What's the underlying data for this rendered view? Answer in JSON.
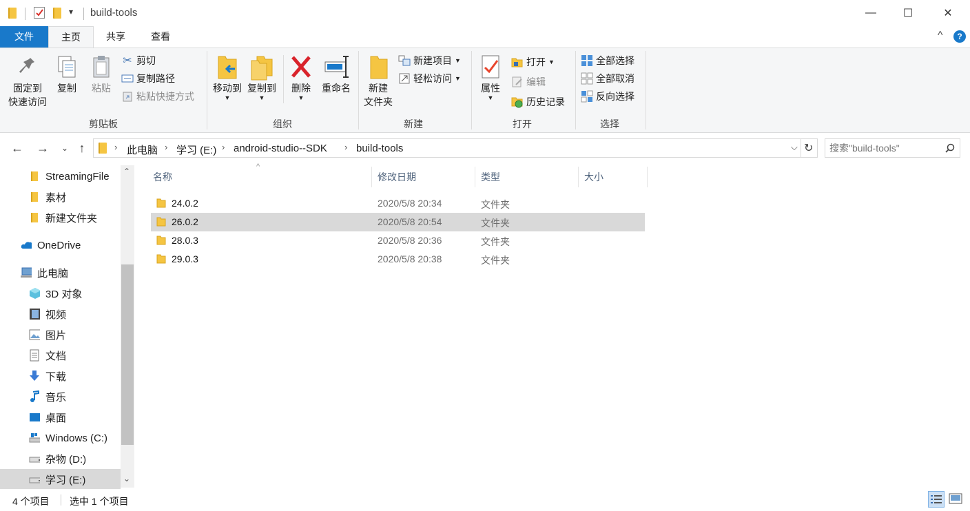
{
  "titlebar": {
    "title": "build-tools",
    "quick_access_dropdown": "▾",
    "minimize": "—",
    "maximize": "☐",
    "close": "✕"
  },
  "ribbon_tabs": {
    "file": "文件",
    "home": "主页",
    "share": "共享",
    "view": "查看",
    "collapse": "^",
    "help": "?"
  },
  "ribbon": {
    "clipboard": {
      "label": "剪贴板",
      "pin_line1": "固定到",
      "pin_line2": "快速访问",
      "copy": "复制",
      "paste": "粘贴",
      "cut": "剪切",
      "copy_path": "复制路径",
      "paste_shortcut": "粘贴快捷方式"
    },
    "organize": {
      "label": "组织",
      "move_to": "移动到",
      "copy_to": "复制到",
      "delete": "删除",
      "rename": "重命名"
    },
    "new": {
      "label": "新建",
      "new_folder_line1": "新建",
      "new_folder_line2": "文件夹",
      "new_item": "新建项目",
      "easy_access": "轻松访问"
    },
    "open": {
      "label": "打开",
      "properties": "属性",
      "open": "打开",
      "edit": "编辑",
      "history": "历史记录"
    },
    "select": {
      "label": "选择",
      "select_all": "全部选择",
      "select_none": "全部取消",
      "invert": "反向选择"
    }
  },
  "address": {
    "breadcrumbs": [
      "此电脑",
      "学习 (E:)",
      "android-studio--SDK",
      "build-tools"
    ],
    "search_placeholder": "搜索\"build-tools\""
  },
  "nav": {
    "items": [
      {
        "label": "StreamingFile",
        "icon": "folder-icon",
        "indent": 1
      },
      {
        "label": "素材",
        "icon": "folder-icon",
        "indent": 1
      },
      {
        "label": "新建文件夹",
        "icon": "folder-icon",
        "indent": 1
      },
      {
        "label": "OneDrive",
        "icon": "onedrive-icon",
        "indent": 0
      },
      {
        "label": "此电脑",
        "icon": "computer-icon",
        "indent": 0
      },
      {
        "label": "3D 对象",
        "icon": "3d-objects-icon",
        "indent": 1
      },
      {
        "label": "视频",
        "icon": "video-icon",
        "indent": 1
      },
      {
        "label": "图片",
        "icon": "pictures-icon",
        "indent": 1
      },
      {
        "label": "文档",
        "icon": "documents-icon",
        "indent": 1
      },
      {
        "label": "下载",
        "icon": "downloads-icon",
        "indent": 1
      },
      {
        "label": "音乐",
        "icon": "music-icon",
        "indent": 1
      },
      {
        "label": "桌面",
        "icon": "desktop-icon",
        "indent": 1
      },
      {
        "label": "Windows (C:)",
        "icon": "windows-drive-icon",
        "indent": 1
      },
      {
        "label": "杂物 (D:)",
        "icon": "drive-icon",
        "indent": 1
      },
      {
        "label": "学习 (E:)",
        "icon": "drive-icon",
        "indent": 1,
        "selected": true
      }
    ]
  },
  "filelist": {
    "columns": [
      "名称",
      "修改日期",
      "类型",
      "大小"
    ],
    "rows": [
      {
        "name": "24.0.2",
        "date": "2020/5/8 20:34",
        "type": "文件夹",
        "size": ""
      },
      {
        "name": "26.0.2",
        "date": "2020/5/8 20:54",
        "type": "文件夹",
        "size": "",
        "selected": true
      },
      {
        "name": "28.0.3",
        "date": "2020/5/8 20:36",
        "type": "文件夹",
        "size": ""
      },
      {
        "name": "29.0.3",
        "date": "2020/5/8 20:38",
        "type": "文件夹",
        "size": ""
      }
    ]
  },
  "status": {
    "count": "4 个项目",
    "selected": "选中 1 个项目"
  },
  "colors": {
    "accent": "#1979ca",
    "folder": "#f5c542",
    "selection": "#d9d9d9"
  }
}
